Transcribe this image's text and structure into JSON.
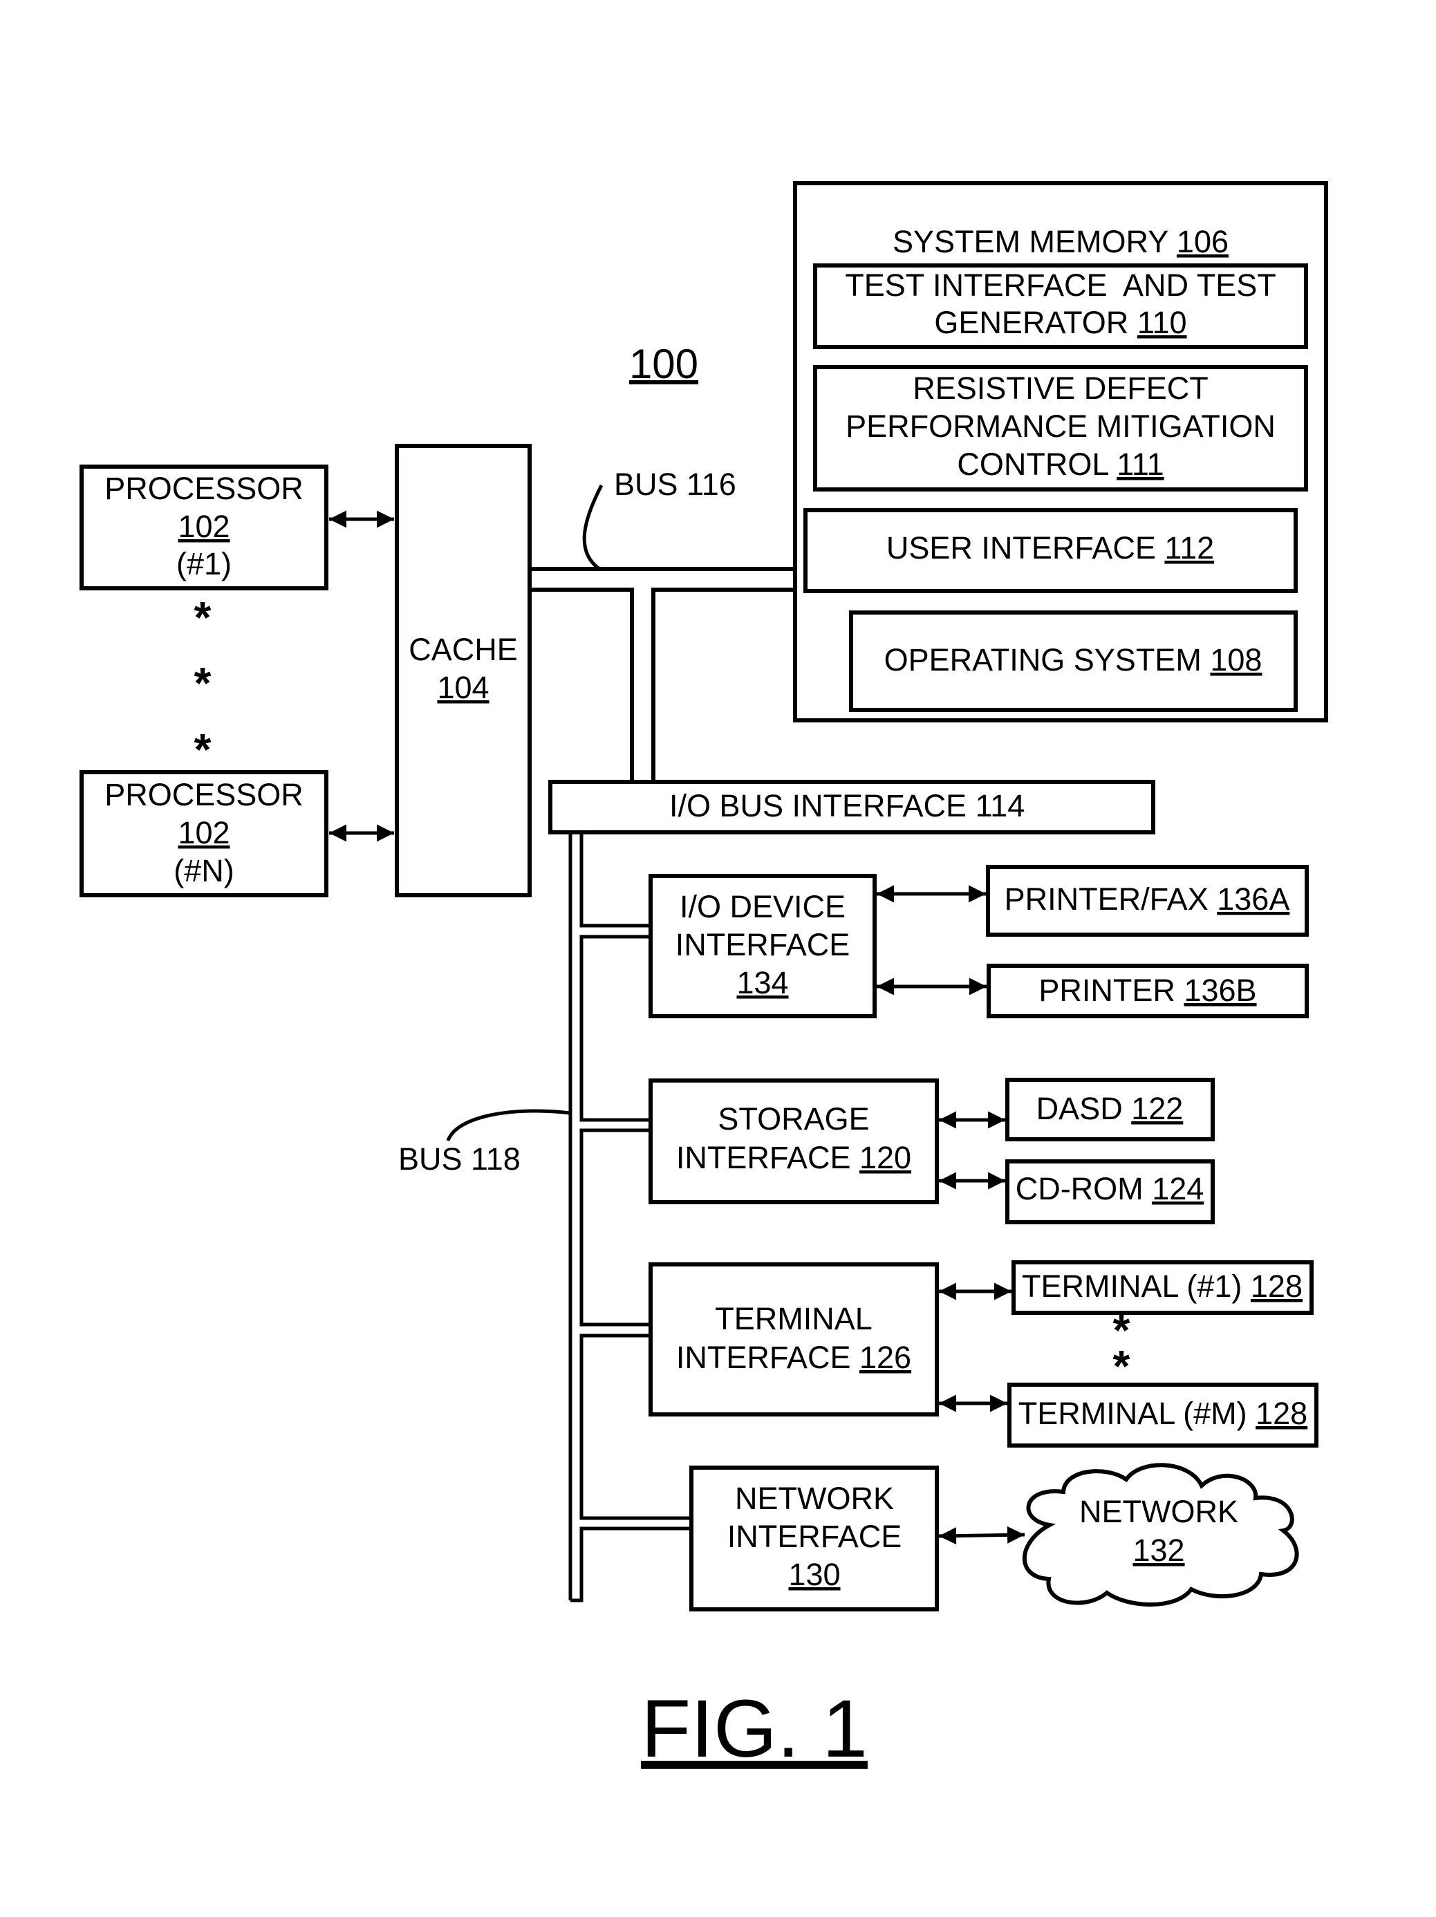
{
  "figure": {
    "label": "FIG. 1",
    "system_ref": "100"
  },
  "processors": [
    {
      "title": "PROCESSOR",
      "ref": "102",
      "instance": "(#1)"
    },
    {
      "title": "PROCESSOR",
      "ref": "102",
      "instance": "(#N)"
    }
  ],
  "ellipsis": "*",
  "cache": {
    "title": "CACHE",
    "ref": "104"
  },
  "system_memory": {
    "title": "SYSTEM MEMORY",
    "ref": "106",
    "test_interface": {
      "line1": "TEST INTERFACE  AND TEST",
      "line2": "GENERATOR",
      "ref": "110"
    },
    "resistive_defect": {
      "line1": "RESISTIVE DEFECT",
      "line2": "PERFORMANCE MITIGATION",
      "line3": "CONTROL",
      "ref": "111"
    },
    "user_interface": {
      "title": "USER INTERFACE",
      "ref": "112"
    },
    "operating_system": {
      "title": "OPERATING SYSTEM",
      "ref": "108"
    }
  },
  "bus_116": {
    "label": "BUS 116"
  },
  "bus_118": {
    "label": "BUS 118"
  },
  "io_bus_interface": {
    "label": "I/O BUS INTERFACE 114"
  },
  "io_device_interface": {
    "line1": "I/O DEVICE",
    "line2": "INTERFACE",
    "ref": "134"
  },
  "printer_fax": {
    "title": "PRINTER/FAX",
    "ref": "136A"
  },
  "printer": {
    "title": "PRINTER",
    "ref": "136B"
  },
  "storage_interface": {
    "line1": "STORAGE",
    "line2": "INTERFACE",
    "ref": "120"
  },
  "dasd": {
    "title": "DASD",
    "ref": "122"
  },
  "cdrom": {
    "title": "CD-ROM",
    "ref": "124"
  },
  "terminal_interface": {
    "line1": "TERMINAL",
    "line2": "INTERFACE",
    "ref": "126"
  },
  "terminals": [
    {
      "title": "TERMINAL (#1)",
      "ref": "128"
    },
    {
      "title": "TERMINAL (#M)",
      "ref": "128"
    }
  ],
  "network_interface": {
    "line1": "NETWORK",
    "line2": "INTERFACE",
    "ref": "130"
  },
  "network": {
    "title": "NETWORK",
    "ref": "132"
  }
}
